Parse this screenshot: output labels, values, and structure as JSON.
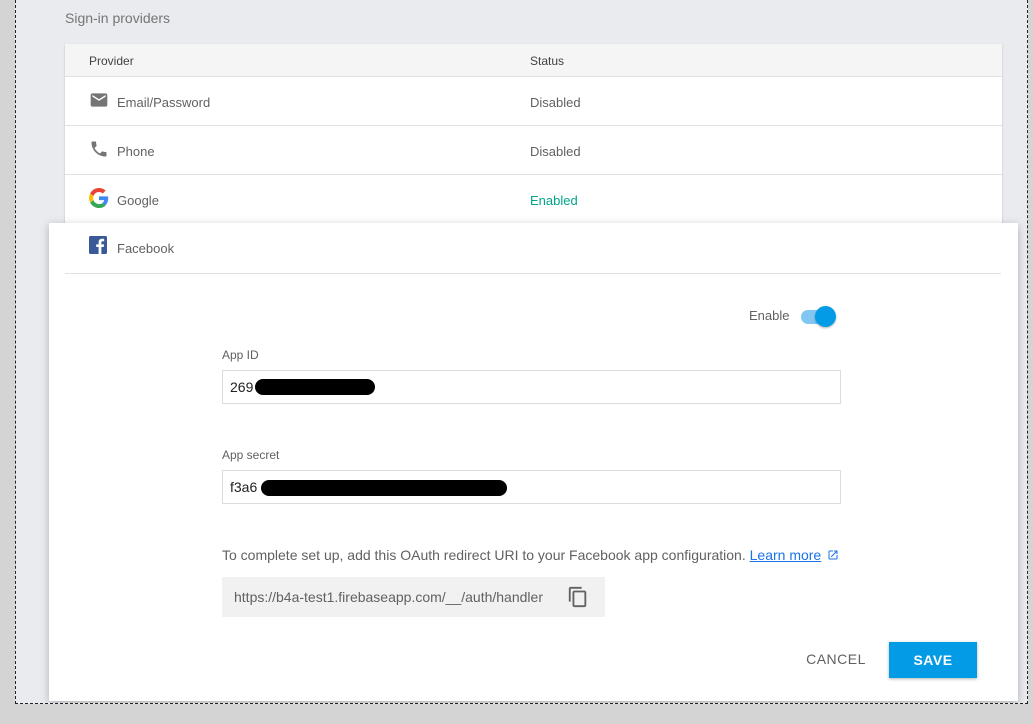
{
  "section": {
    "title": "Sign-in providers"
  },
  "table": {
    "headers": [
      "Provider",
      "Status"
    ],
    "rows": [
      {
        "icon": "email-icon",
        "name": "Email/Password",
        "status": "Disabled"
      },
      {
        "icon": "phone-icon",
        "name": "Phone",
        "status": "Disabled"
      },
      {
        "icon": "google-icon",
        "name": "Google",
        "status": "Enabled"
      }
    ]
  },
  "panel": {
    "provider": {
      "icon": "facebook-icon",
      "name": "Facebook"
    },
    "enable_label": "Enable",
    "enabled": true,
    "app_id": {
      "label": "App ID",
      "value": "269"
    },
    "app_secret": {
      "label": "App secret",
      "value": "f3a6"
    },
    "help_text": "To complete set up, add this OAuth redirect URI to your Facebook app configuration.",
    "learn_more": "Learn more",
    "redirect_uri": "https://b4a-test1.firebaseapp.com/__/auth/handler",
    "cancel_label": "CANCEL",
    "save_label": "SAVE"
  },
  "colors": {
    "accent": "#039be5",
    "enabled_status": "#00a68a",
    "link": "#1a73e8",
    "facebook": "#3b5998"
  }
}
